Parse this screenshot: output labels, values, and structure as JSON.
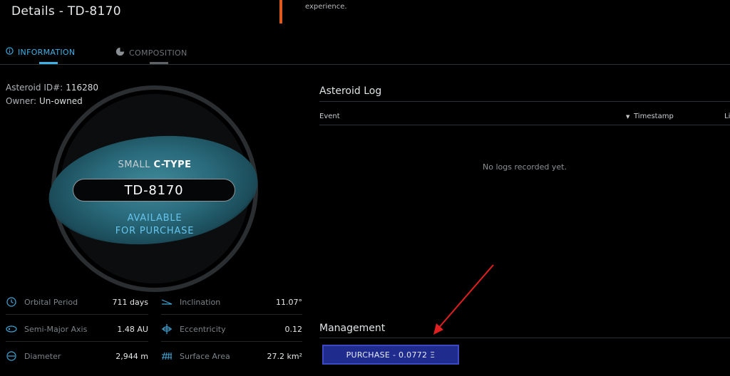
{
  "header": {
    "title": "Details - TD-8170",
    "experience_text": "experience."
  },
  "tabs": [
    {
      "label": "INFORMATION",
      "icon": "info-circle-icon",
      "active": true
    },
    {
      "label": "COMPOSITION",
      "icon": "pie-chart-icon",
      "active": false
    }
  ],
  "info": {
    "id_label": "Asteroid ID#:",
    "id_value": "116280",
    "owner_label": "Owner:",
    "owner_value": "Un-owned"
  },
  "asteroid": {
    "size": "SMALL",
    "type": "C-TYPE",
    "name": "TD-8170",
    "status_line1": "AVAILABLE",
    "status_line2": "FOR PURCHASE"
  },
  "stats": [
    {
      "label": "Orbital Period",
      "value": "711 days",
      "icon": "clock-icon"
    },
    {
      "label": "Inclination",
      "value": "11.07°",
      "icon": "inclination-icon"
    },
    {
      "label": "Semi-Major Axis",
      "value": "1.48 AU",
      "icon": "orbit-icon"
    },
    {
      "label": "Eccentricity",
      "value": "0.12",
      "icon": "eccentricity-icon"
    },
    {
      "label": "Diameter",
      "value": "2,944 m",
      "icon": "diameter-icon"
    },
    {
      "label": "Surface Area",
      "value": "27.2 km²",
      "icon": "surface-grid-icon"
    }
  ],
  "log": {
    "title": "Asteroid Log",
    "col_event": "Event",
    "col_timestamp": "Timestamp",
    "col_partial": "Li",
    "empty": "No logs recorded yet."
  },
  "management": {
    "title": "Management",
    "purchase_label": "PURCHASE - 0.0772 Ξ"
  },
  "colors": {
    "accent": "#3fb0e6",
    "button_bg": "#1f2c8e",
    "orange": "#e05a1f",
    "annotation_arrow": "#e02020"
  }
}
